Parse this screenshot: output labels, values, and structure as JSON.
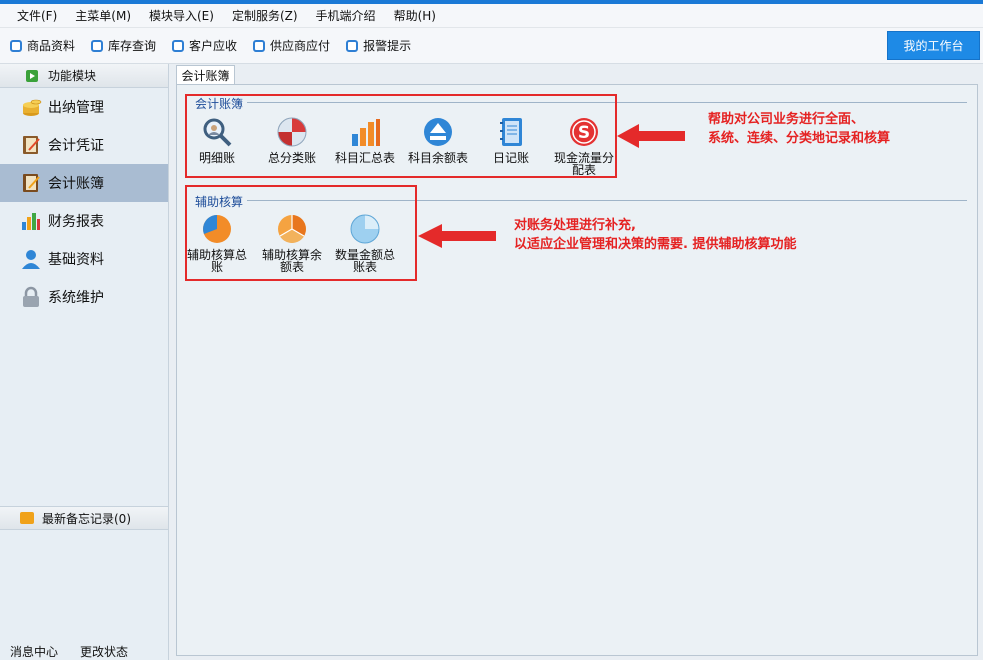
{
  "menu": [
    "文件(F)",
    "主菜单(M)",
    "模块导入(E)",
    "定制服务(Z)",
    "手机端介绍",
    "帮助(H)"
  ],
  "toolbar": {
    "items": [
      "商品资料",
      "库存查询",
      "客户应收",
      "供应商应付",
      "报警提示"
    ],
    "workbench": "我的工作台"
  },
  "sidebar": {
    "header": "功能模块",
    "items": [
      {
        "label": "出纳管理",
        "icon": "coins-icon"
      },
      {
        "label": "会计凭证",
        "icon": "notebook-icon"
      },
      {
        "label": "会计账簿",
        "icon": "ledger-icon"
      },
      {
        "label": "财务报表",
        "icon": "bar-chart-icon"
      },
      {
        "label": "基础资料",
        "icon": "user-icon"
      },
      {
        "label": "系统维护",
        "icon": "lock-icon"
      }
    ],
    "active_index": 2,
    "memo": "最新备忘记录(0)",
    "status": [
      "消息中心",
      "更改状态"
    ]
  },
  "tab": "会计账簿",
  "groups": {
    "ledger": {
      "title": "会计账簿",
      "items": [
        "明细账",
        "总分类账",
        "科目汇总表",
        "科目余额表",
        "日记账",
        "现金流量分",
        "配表"
      ]
    },
    "aux": {
      "title": "辅助核算",
      "items": [
        {
          "l1": "辅助核算总",
          "l2": "账"
        },
        {
          "l1": "辅助核算余",
          "l2": "额表"
        },
        {
          "l1": "数量金额总",
          "l2": "账表"
        }
      ]
    }
  },
  "annotations": {
    "ledger": [
      "帮助对公司业务进行全面、",
      "系统、连续、分类地记录和核算"
    ],
    "aux": [
      "对账务处理进行补充,",
      "以适应企业管理和决策的需要. 提供辅助核算功能"
    ]
  },
  "colors": {
    "accent": "#1e8ae6",
    "highlight": "#e42a2a",
    "active": "#a9bcd2"
  }
}
